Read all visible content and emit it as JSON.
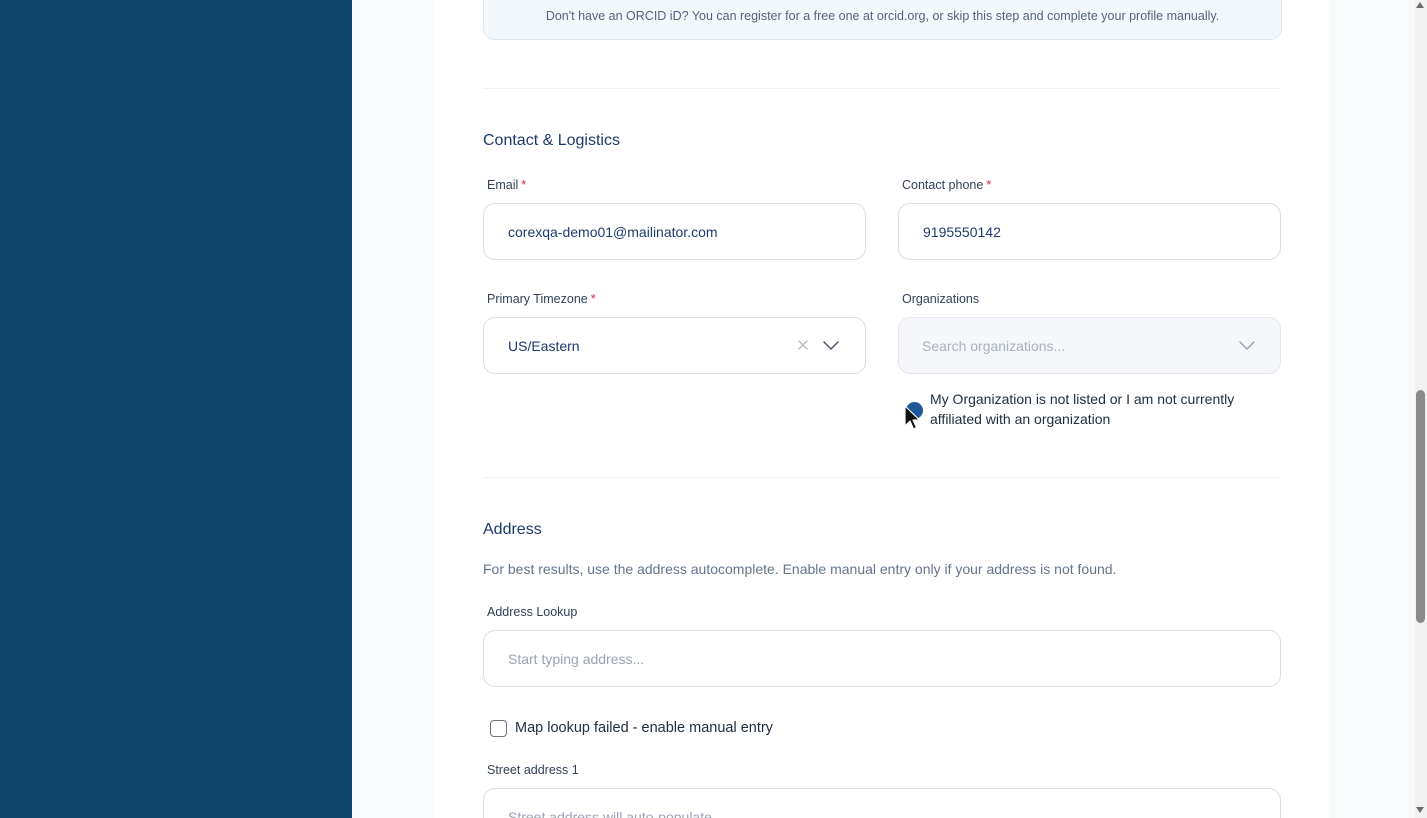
{
  "orcid_note": "Don't have an ORCID iD? You can register for a free one at orcid.org, or skip this step and complete your profile manually.",
  "contact": {
    "title": "Contact & Logistics",
    "email": {
      "label": "Email",
      "required": "*",
      "value": "corexqa-demo01@mailinator.com"
    },
    "phone": {
      "label": "Contact phone",
      "required": "*",
      "value": "9195550142"
    },
    "timezone": {
      "label": "Primary Timezone",
      "required": "*",
      "value": "US/Eastern"
    },
    "organizations": {
      "label": "Organizations",
      "placeholder": "Search organizations...",
      "not_listed_label": "My Organization is not listed or I am not currently affiliated with an organization"
    }
  },
  "address": {
    "title": "Address",
    "hint": "For best results, use the address autocomplete. Enable manual entry only if your address is not found.",
    "lookup": {
      "label": "Address Lookup",
      "placeholder": "Start typing address..."
    },
    "manual_entry_label": "Map lookup failed - enable manual entry",
    "street1": {
      "label": "Street address 1",
      "placeholder": "Street address will auto-populate"
    }
  },
  "colors": {
    "sidebar": "#0f446b",
    "accent": "#1f5896",
    "title": "#1e3a6e",
    "required": "#e11d48"
  },
  "icons": {
    "clear": "close-icon",
    "dropdown": "chevron-down-icon",
    "cursor": "mouse-pointer-icon"
  }
}
